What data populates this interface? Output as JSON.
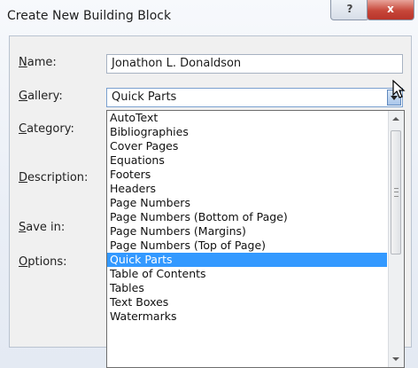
{
  "dialog": {
    "title": "Create New Building Block",
    "help_label": "?",
    "close_label": "x"
  },
  "fields": {
    "name_label": "Name:",
    "name_value": "Jonathon L. Donaldson",
    "gallery_label": "Gallery:",
    "gallery_value": "Quick Parts",
    "category_label": "Category:",
    "description_label": "Description:",
    "save_in_label": "Save in:",
    "options_label": "Options:"
  },
  "gallery_options": [
    "AutoText",
    "Bibliographies",
    "Cover Pages",
    "Equations",
    "Footers",
    "Headers",
    "Page Numbers",
    "Page Numbers (Bottom of Page)",
    "Page Numbers (Margins)",
    "Page Numbers (Top of Page)",
    "Quick Parts",
    "Table of Contents",
    "Tables",
    "Text Boxes",
    "Watermarks"
  ],
  "selected_option": "Quick Parts",
  "colors": {
    "selection": "#3399ff",
    "close_button": "#c7473a"
  }
}
